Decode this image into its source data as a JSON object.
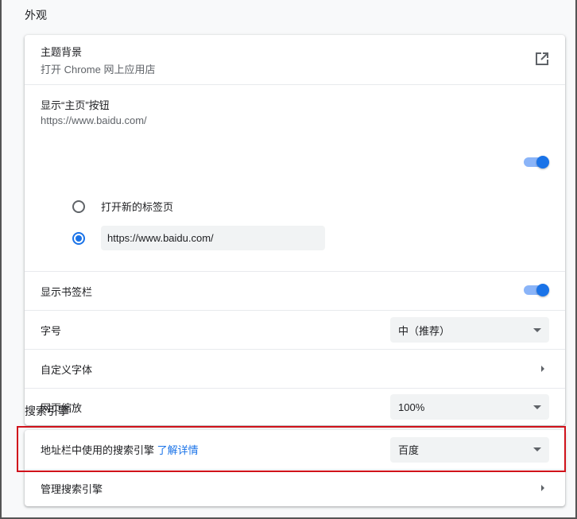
{
  "appearance": {
    "title": "外观",
    "theme": {
      "label": "主题背景",
      "sub": "打开 Chrome 网上应用店",
      "icon": "open-in-new-icon"
    },
    "home_button": {
      "label": "显示“主页”按钮",
      "sub": "https://www.baidu.com/",
      "enabled": true,
      "options": [
        {
          "label": "打开新的标签页",
          "selected": false
        },
        {
          "value": "https://www.baidu.com/",
          "selected": true
        }
      ]
    },
    "bookmarks_bar": {
      "label": "显示书签栏",
      "enabled": true
    },
    "font_size": {
      "label": "字号",
      "value": "中（推荐）"
    },
    "custom_fonts": {
      "label": "自定义字体"
    },
    "page_zoom": {
      "label": "网页缩放",
      "value": "100%"
    }
  },
  "search": {
    "title": "搜索引擎",
    "engine": {
      "label": "地址栏中使用的搜索引擎",
      "link": "了解详情",
      "value": "百度"
    },
    "manage": {
      "label": "管理搜索引擎"
    }
  },
  "colors": {
    "accent": "#1a73e8",
    "highlight": "#d0121b"
  }
}
